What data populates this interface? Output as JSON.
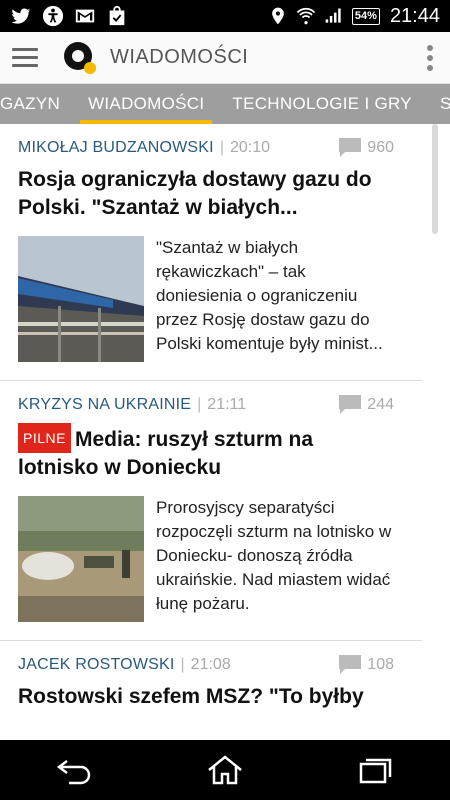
{
  "status_bar": {
    "icons_left": [
      "twitter-icon",
      "accessibility-icon",
      "gmail-icon",
      "shopping-bag-icon"
    ],
    "icons_right": [
      "location-icon",
      "wifi-icon",
      "signal-icon"
    ],
    "battery": "54%",
    "time": "21:44"
  },
  "app_bar": {
    "title": "WIADOMOŚCI",
    "logo_accent": "#f6b800"
  },
  "tabs": [
    {
      "label": "GAZYN",
      "active": false
    },
    {
      "label": "WIADOMOŚCI",
      "active": true
    },
    {
      "label": "TECHNOLOGIE I GRY",
      "active": false
    },
    {
      "label": "SP",
      "active": false
    }
  ],
  "articles": [
    {
      "author": "MIKOŁAJ BUDZANOWSKI",
      "time": "20:10",
      "comments": "960",
      "badge": "",
      "headline": "Rosja ograniczyła dostawy gazu do Polski. \"Szantaż w białych...",
      "excerpt": "\"Szantaż w białych rękawiczkach\" – tak doniesienia o ograniczeniu przez Rosję dostaw gazu do Polski komentuje były minist..."
    },
    {
      "author": "KRYZYS NA UKRAINIE",
      "time": "21:11",
      "comments": "244",
      "badge": "PILNE",
      "headline": "Media: ruszył szturm na lotnisko w Doniecku",
      "excerpt": "Prorosyjscy separatyści rozpoczęli szturm na lotnisko w Doniecku- donoszą źródła ukraińskie. Nad miastem widać łunę pożaru."
    },
    {
      "author": "JACEK ROSTOWSKI",
      "time": "21:08",
      "comments": "108",
      "badge": "",
      "headline": "Rostowski szefem MSZ? \"To byłby",
      "excerpt": ""
    }
  ],
  "nav_bar": {
    "buttons": [
      "back-icon",
      "home-icon",
      "recent-apps-icon"
    ]
  },
  "colors": {
    "accent": "#f6b800",
    "author": "#2a5a7e",
    "badge": "#e0261b",
    "tab_bar": "#9e9e9e"
  }
}
